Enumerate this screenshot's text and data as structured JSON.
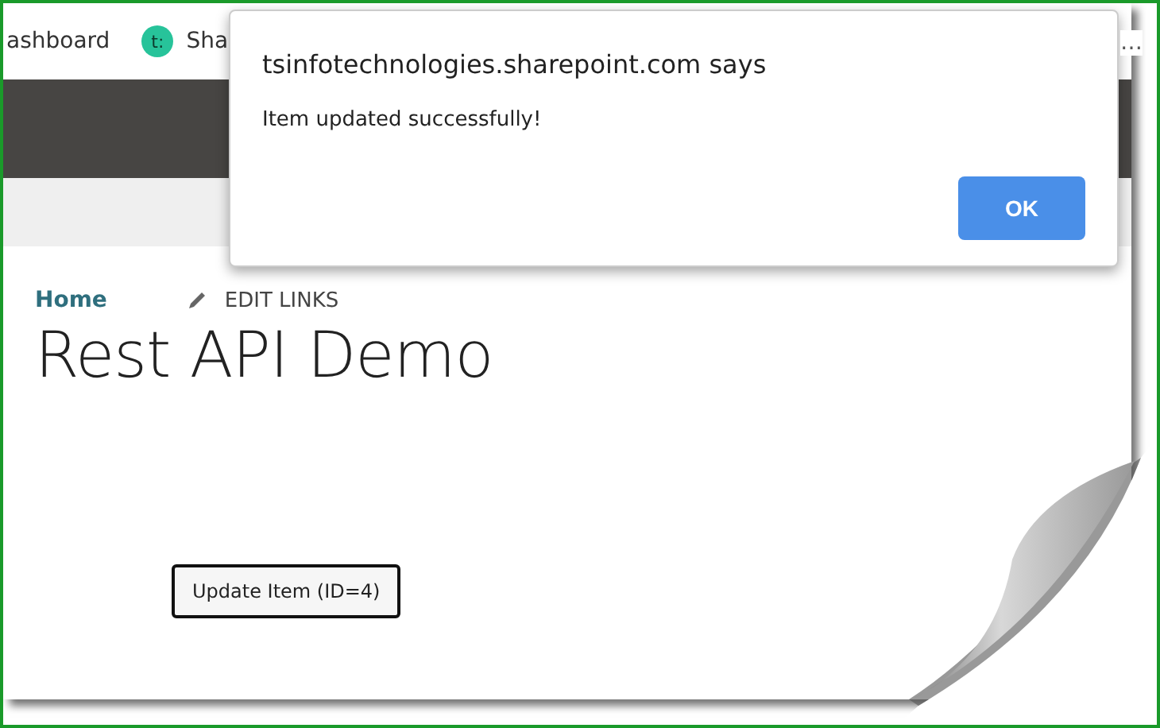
{
  "bookmarks": [
    {
      "label": "ashboard",
      "kind": "text"
    },
    {
      "label": "Sha",
      "kind": "avatar",
      "badge": "t:"
    }
  ],
  "bookmarks_overflow": "…",
  "breadcrumb": {
    "home": "Home",
    "edit_links": "EDIT LINKS"
  },
  "page_title": "Rest API Demo",
  "update_button": "Update Item (ID=4)",
  "dialog": {
    "title": "tsinfotechnologies.sharepoint.com says",
    "message": "Item updated successfully!",
    "ok": "OK"
  }
}
